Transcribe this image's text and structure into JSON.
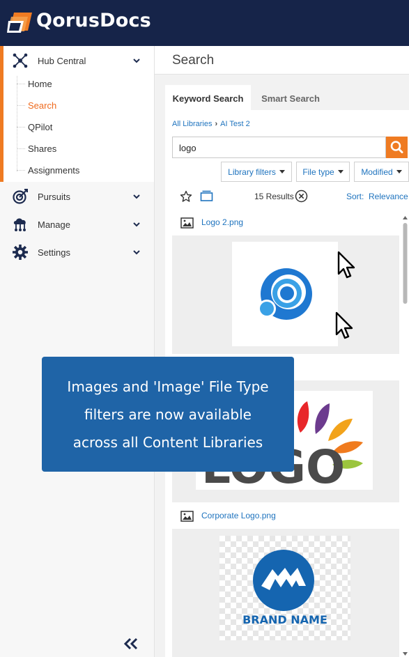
{
  "app": {
    "brand": "QorusDocs"
  },
  "sidebar": {
    "hub_central": {
      "label": "Hub Central",
      "items": [
        "Home",
        "Search",
        "QPilot",
        "Shares",
        "Assignments"
      ],
      "active": "Search"
    },
    "sections": [
      {
        "label": "Pursuits",
        "icon": "target-icon"
      },
      {
        "label": "Manage",
        "icon": "cloud-network-icon"
      },
      {
        "label": "Settings",
        "icon": "gear-icon"
      }
    ],
    "collapse_icon": "double-chevron-left-icon"
  },
  "main": {
    "title": "Search",
    "tabs": [
      "Keyword Search",
      "Smart Search"
    ],
    "active_tab": "Keyword Search",
    "breadcrumb": [
      "All Libraries",
      "AI Test 2"
    ],
    "search": {
      "value": "logo"
    },
    "filters": [
      "Library filters",
      "File type",
      "Modified"
    ],
    "results_count": "15 Results",
    "sort_label": "Sort:",
    "sort_value": "Relevance",
    "results": [
      {
        "name": "Logo 2.png"
      },
      {
        "name": ""
      },
      {
        "name": "Corporate Logo.png"
      }
    ],
    "thumb_texts": {
      "logo_word": "LOGO",
      "brand_name": "BRAND NAME"
    }
  },
  "callout": {
    "lines": [
      "Images and 'Image' File Type",
      "filters are now available",
      "across all Content Libraries"
    ]
  },
  "colors": {
    "topbar": "#162449",
    "accent": "#ef7b22",
    "link": "#1e73be",
    "callout": "#1f64a7"
  }
}
